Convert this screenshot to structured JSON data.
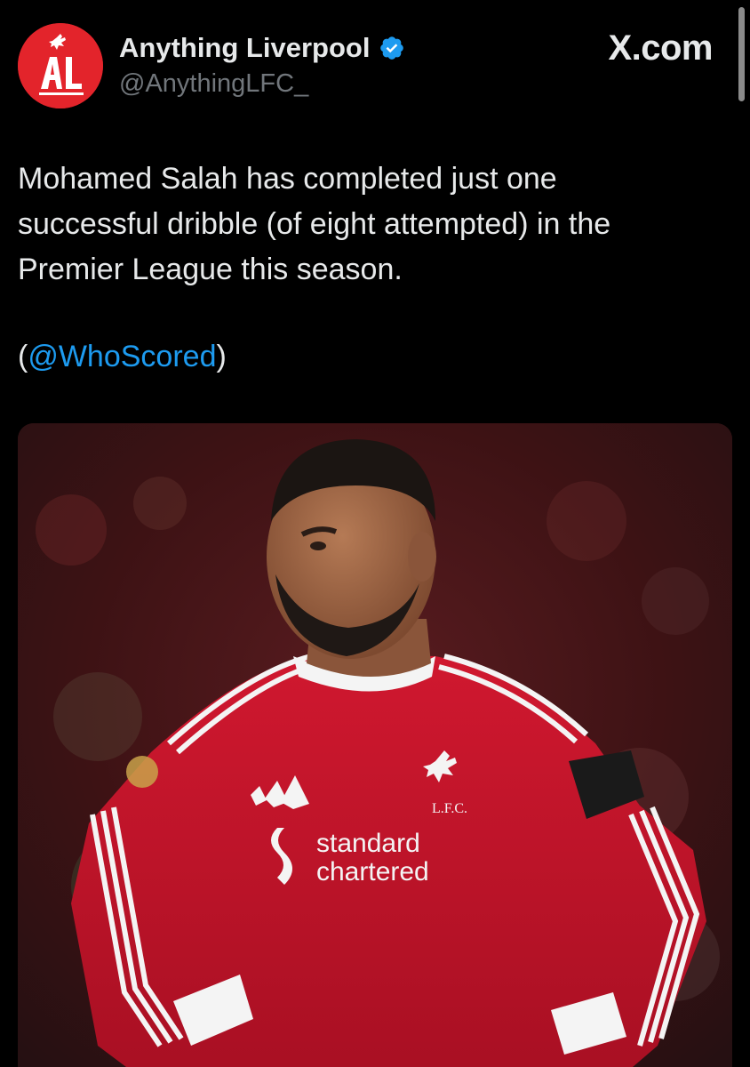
{
  "account": {
    "display_name": "Anything Liverpool",
    "handle": "@AnythingLFC_",
    "avatar_monogram": "AL",
    "avatar_color": "#e3242b",
    "verified_icon": "verified-badge-icon",
    "verified_color": "#1d9bf0"
  },
  "brand": {
    "label": "X.com"
  },
  "tweet": {
    "lines": [
      "Mohamed Salah has completed just one",
      "successful dribble (of eight attempted) in the",
      "Premier League this season."
    ],
    "mention_open": "(",
    "mention": "@WhoScored",
    "mention_close": ")"
  },
  "media": {
    "kit_sponsor_line1": "standard",
    "kit_sponsor_line2": "chartered",
    "kit_crest_text": "L.F.C.",
    "kit_color": "#c8102e"
  }
}
